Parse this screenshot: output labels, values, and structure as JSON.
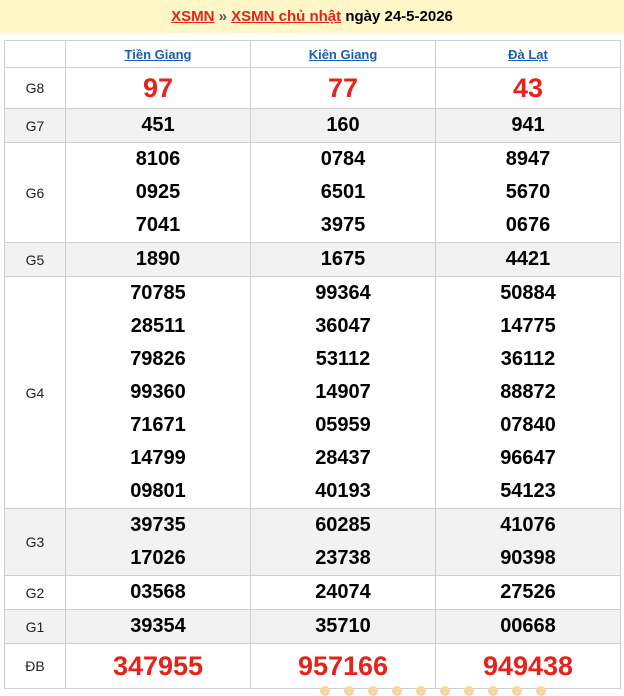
{
  "header": {
    "link1": "XSMN",
    "separator": " » ",
    "link2": "XSMN chủ nhật",
    "date_text": " ngày 24-5-2026"
  },
  "provinces": [
    "Tiền Giang",
    "Kiên Giang",
    "Đà Lạt"
  ],
  "prizes": [
    {
      "label": "G8",
      "values": [
        [
          "97"
        ],
        [
          "77"
        ],
        [
          "43"
        ]
      ]
    },
    {
      "label": "G7",
      "values": [
        [
          "451"
        ],
        [
          "160"
        ],
        [
          "941"
        ]
      ]
    },
    {
      "label": "G6",
      "values": [
        [
          "8106",
          "0925",
          "7041"
        ],
        [
          "0784",
          "6501",
          "3975"
        ],
        [
          "8947",
          "5670",
          "0676"
        ]
      ]
    },
    {
      "label": "G5",
      "values": [
        [
          "1890"
        ],
        [
          "1675"
        ],
        [
          "4421"
        ]
      ]
    },
    {
      "label": "G4",
      "values": [
        [
          "70785",
          "28511",
          "79826",
          "99360",
          "71671",
          "14799",
          "09801"
        ],
        [
          "99364",
          "36047",
          "53112",
          "14907",
          "05959",
          "28437",
          "40193"
        ],
        [
          "50884",
          "14775",
          "36112",
          "88872",
          "07840",
          "96647",
          "54123"
        ]
      ]
    },
    {
      "label": "G3",
      "values": [
        [
          "39735",
          "17026"
        ],
        [
          "60285",
          "23738"
        ],
        [
          "41076",
          "90398"
        ]
      ]
    },
    {
      "label": "G2",
      "values": [
        [
          "03568"
        ],
        [
          "24074"
        ],
        [
          "27526"
        ]
      ]
    },
    {
      "label": "G1",
      "values": [
        [
          "39354"
        ],
        [
          "35710"
        ],
        [
          "00668"
        ]
      ]
    },
    {
      "label": "ĐB",
      "values": [
        [
          "347955"
        ],
        [
          "957166"
        ],
        [
          "949438"
        ]
      ]
    }
  ],
  "colors": {
    "accent_red": "#e5231b",
    "link_blue": "#1a5fb4",
    "header_bg": "#fff7c8",
    "row_shade": "#f2f2f2"
  }
}
